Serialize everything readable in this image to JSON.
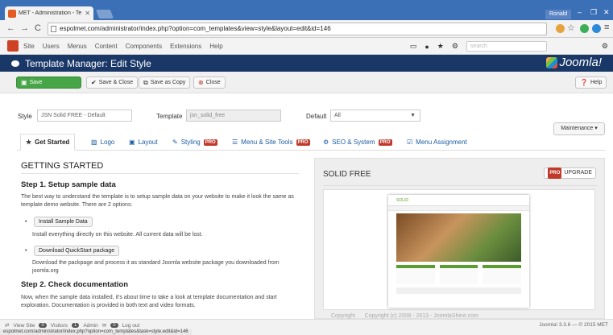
{
  "browser": {
    "tab_title": "MET - Administration - Te",
    "user": "Ronald",
    "url": "espolmet.com/administrator/index.php?option=com_templates&view=style&layout=edit&id=146"
  },
  "admin_menu": {
    "items": [
      "Site",
      "Users",
      "Menus",
      "Content",
      "Components",
      "Extensions",
      "Help"
    ],
    "search_placeholder": "search"
  },
  "header": {
    "title": "Template Manager: Edit Style",
    "brand": "Joomla!"
  },
  "toolbar": {
    "save": "Save",
    "save_close": "Save & Close",
    "save_copy": "Save as Copy",
    "close": "Close",
    "help": "Help"
  },
  "style_form": {
    "style_label": "Style",
    "style_value": "JSN Solid FREE - Default",
    "template_label": "Template",
    "template_value": "jsn_solid_free",
    "default_label": "Default",
    "default_value": "All",
    "maintenance": "Maintenance"
  },
  "tabs": [
    {
      "label": "Get Started",
      "pro": ""
    },
    {
      "label": "Logo",
      "pro": ""
    },
    {
      "label": "Layout",
      "pro": ""
    },
    {
      "label": "Styling",
      "pro": "PRO"
    },
    {
      "label": "Menu & Site Tools",
      "pro": "PRO"
    },
    {
      "label": "SEO & System",
      "pro": "PRO"
    },
    {
      "label": "Menu Assignment",
      "pro": ""
    }
  ],
  "content": {
    "heading": "GETTING STARTED",
    "step1_title": "Step 1. Setup sample data",
    "step1_text": "The best way to understand the template is to setup sample data on your website to make it look the same as template demo website. There are 2 options:",
    "install_button": "Install Sample Data",
    "install_text": "Install everything directly on this website. All current data will be lost.",
    "download_button": "Download QuickStart package",
    "download_text": "Download the packpage and process it as standard Joomla website package you downloaded from joomla.org",
    "step2_title": "Step 2. Check documentation",
    "step2_text": "Now, when the sample data installed, it's about time to take a look at template documentation and start exploration. Documentation is provided in both text and video formats."
  },
  "panel": {
    "title": "SOLID FREE",
    "pro_badge": "PRO",
    "upgrade": "UPGRADE",
    "preview_brand": "SOLID",
    "copyright_label": "Copyright",
    "copyright_text": "Copyright (c) 2008 - 2013 - JoomlaShine.com"
  },
  "status": {
    "view_site": "View Site",
    "visitors_count": "0",
    "visitors": "Visitors",
    "admin_count": "1",
    "admin": "Admin",
    "messages_count": "0",
    "logout": "Log out",
    "version": "Joomla! 3.3.6 — © 2015 MET",
    "link_preview": "espolmet.com/administrator/index.php?option=com_templates&task=style.edit&id=146"
  }
}
